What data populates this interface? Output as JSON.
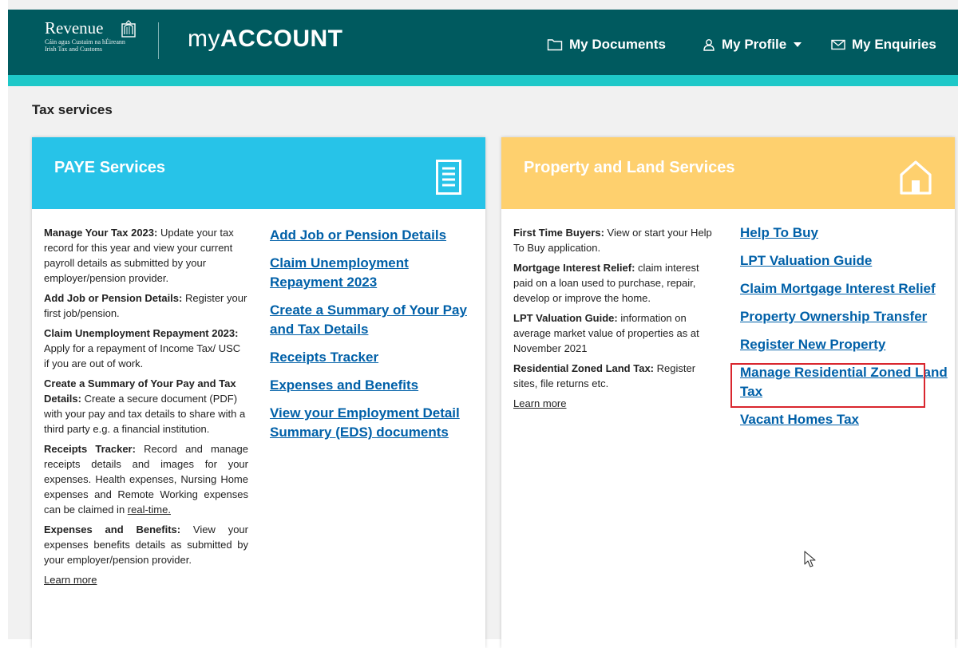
{
  "header": {
    "logo_word": "Revenue",
    "logo_sub_1": "Cáin agus Custaim na hÉireann",
    "logo_sub_2": "Irish Tax and Customs",
    "brand_light": "my",
    "brand_bold": "ACCOUNT",
    "nav": [
      {
        "label": "My Documents",
        "icon": "folder-icon"
      },
      {
        "label": "My Profile",
        "icon": "user-icon"
      },
      {
        "label": "My Enquiries",
        "icon": "envelope-icon"
      }
    ]
  },
  "section_title": "Tax services",
  "colors": {
    "header": "#005a5f",
    "stripe": "#1ec8c8",
    "paye": "#27c3e8",
    "property": "#fed06e",
    "link": "#0060a8",
    "highlight": "#d9262e"
  },
  "paye": {
    "title": "PAYE Services",
    "icon": "document-icon",
    "desc": [
      {
        "bold": "Manage Your Tax 2023:",
        "text": " Update your tax record for this year and view your current payroll details as submitted by your employer/pension provider."
      },
      {
        "bold": "Add Job or Pension Details:",
        "text": " Register your first job/pension."
      },
      {
        "bold": "Claim Unemployment Repayment 2023:",
        "text": " Apply for a repayment of Income Tax/ USC if you are out of work."
      },
      {
        "bold": "Create a Summary of Your Pay and Tax Details:",
        "text": " Create a secure document (PDF) with your pay and tax details to share with a third party e.g. a financial institution."
      },
      {
        "bold": "Receipts Tracker:",
        "text": " Record and manage receipts details and images for your expenses. Health expenses, Nursing Home expenses and Remote Working expenses can be claimed in ",
        "link": "real-time."
      },
      {
        "bold": "Expenses and Benefits:",
        "text": " View your expenses benefits details as submitted by your employer/pension provider."
      }
    ],
    "learn_more": "Learn more",
    "links": [
      "Add Job or Pension Details",
      "Claim Unemployment Repayment 2023",
      "Create a Summary of Your Pay and Tax Details",
      "Receipts Tracker",
      "Expenses and Benefits",
      "View your Employment Detail Summary (EDS) documents"
    ]
  },
  "property": {
    "title": "Property and Land Services",
    "icon": "house-icon",
    "desc": [
      {
        "bold": "First Time Buyers:",
        "text": " View or start your Help To Buy application."
      },
      {
        "bold": "Mortgage Interest Relief:",
        "text": " claim interest paid on a loan used to purchase, repair, develop or improve the home."
      },
      {
        "bold": "LPT Valuation Guide:",
        "text": " information on average market value of properties as at November 2021"
      },
      {
        "bold": "Residential Zoned Land Tax:",
        "text": " Register sites, file returns etc."
      }
    ],
    "learn_more": "Learn more",
    "links": [
      "Help To Buy",
      "LPT Valuation Guide",
      "Claim Mortgage Interest Relief",
      "Property Ownership Transfer",
      "Register New Property",
      "Manage Residential Zoned Land Tax",
      "Vacant Homes Tax"
    ]
  }
}
